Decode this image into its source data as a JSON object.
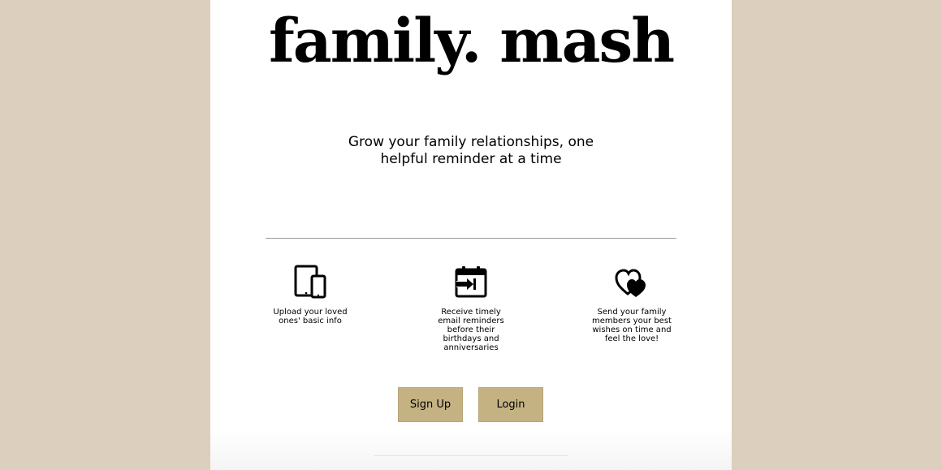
{
  "brand": {
    "logo": "family. mash"
  },
  "hero": {
    "tagline": "Grow your family relationships, one helpful reminder at a time"
  },
  "features": [
    {
      "icon": "devices-icon",
      "text": "Upload your loved ones' basic info"
    },
    {
      "icon": "calendar-reminder-icon",
      "text": "Receive timely email reminders before their birthdays and anniversaries"
    },
    {
      "icon": "hearts-icon",
      "text": "Send your family members your best wishes on time and feel the love!"
    }
  ],
  "actions": {
    "signup_label": "Sign Up",
    "login_label": "Login"
  },
  "colors": {
    "background": "#dccfbd",
    "panel": "#ffffff",
    "button": "#c4b283"
  }
}
